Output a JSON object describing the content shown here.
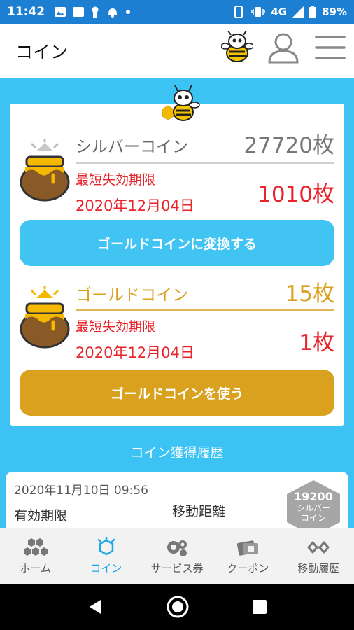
{
  "status_bar": {
    "time": "11:42",
    "network": "4G",
    "battery": "89%"
  },
  "header": {
    "title": "コイン"
  },
  "silver": {
    "name": "シルバーコイン",
    "count": "27720枚",
    "expiry_label": "最短失効期限",
    "expiry_date": "2020年12月04日",
    "expiry_count": "1010枚",
    "button_label": "ゴールドコインに変換する"
  },
  "gold": {
    "name": "ゴールドコイン",
    "count": "15枚",
    "expiry_label": "最短失効期限",
    "expiry_date": "2020年12月04日",
    "expiry_count": "1枚",
    "button_label": "ゴールドコインを使う"
  },
  "history": {
    "title": "コイン獲得履歴",
    "items": [
      {
        "date": "2020年11月10日 09:56",
        "expiry_label": "有効期限",
        "distance_label": "移動距離",
        "badge_value": "19200",
        "badge_label_line1": "シルバー",
        "badge_label_line2": "コイン"
      }
    ]
  },
  "nav": {
    "items": [
      {
        "label": "ホーム",
        "icon": "honeycomb-icon"
      },
      {
        "label": "コイン",
        "icon": "coin-icon",
        "active": true
      },
      {
        "label": "サービス券",
        "icon": "service-ticket-icon"
      },
      {
        "label": "クーポン",
        "icon": "coupon-icon"
      },
      {
        "label": "移動履歴",
        "icon": "history-icon"
      }
    ]
  },
  "colors": {
    "status_bar": "#1c7fd2",
    "content_bg": "#3dc3f3",
    "silver_button": "#42c4f3",
    "gold_button": "#d9a11e",
    "gold_text": "#d9a11e",
    "expiry_red": "#e8232a",
    "nav_active": "#1ba8e6"
  }
}
